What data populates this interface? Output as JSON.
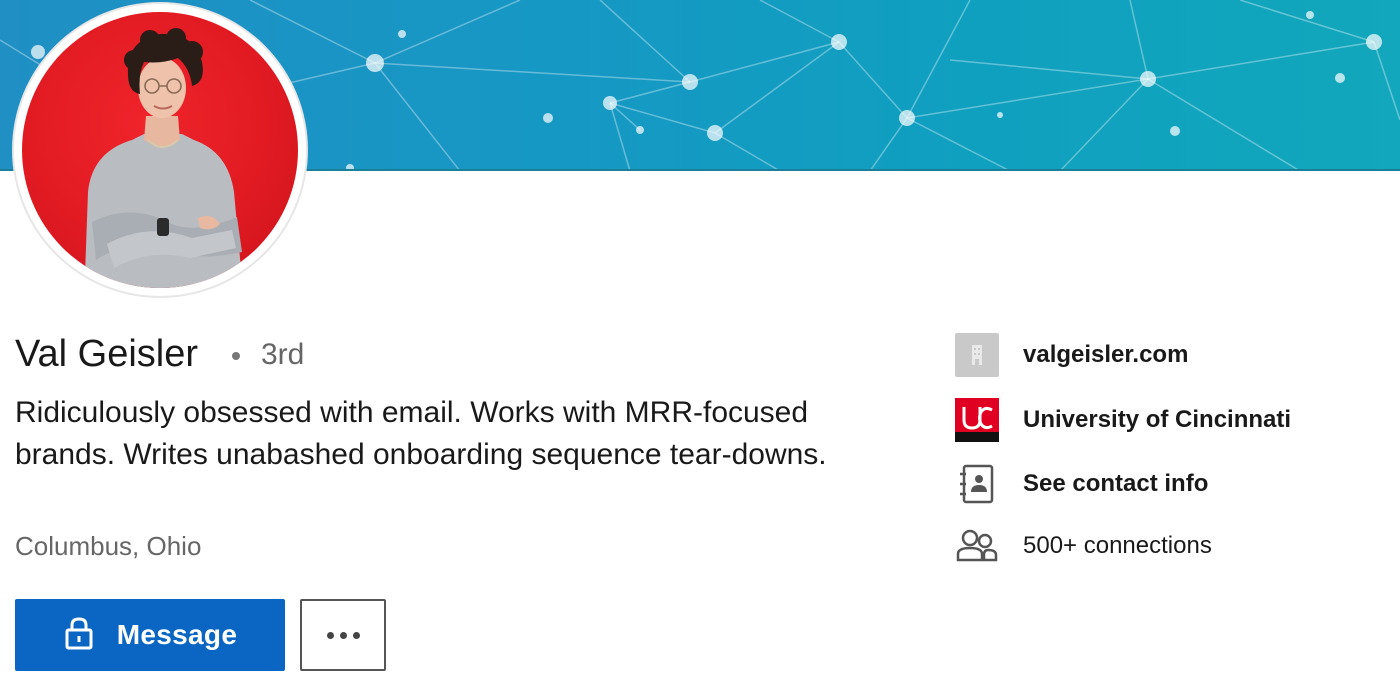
{
  "profile": {
    "name": "Val Geisler",
    "degree": "3rd",
    "headline": "Ridiculously obsessed with email. Works with MRR-focused brands. Writes unabashed onboarding sequence tear-downs.",
    "location": "Columbus, Ohio"
  },
  "actions": {
    "message_label": "Message",
    "more_label": "..."
  },
  "side": {
    "website": "valgeisler.com",
    "education": "University of Cincinnati",
    "contact": "See contact info",
    "connections": "500+ connections"
  },
  "icons": {
    "banner": "network-pattern",
    "website": "building-icon",
    "education": "university-logo",
    "contact": "address-book-icon",
    "connections": "people-icon",
    "message": "lock-icon"
  },
  "colors": {
    "banner": "#1698c4",
    "avatar_bg": "#e11a22",
    "primary": "#0a66c2",
    "muted_text": "#666666",
    "university": "#e00122"
  }
}
